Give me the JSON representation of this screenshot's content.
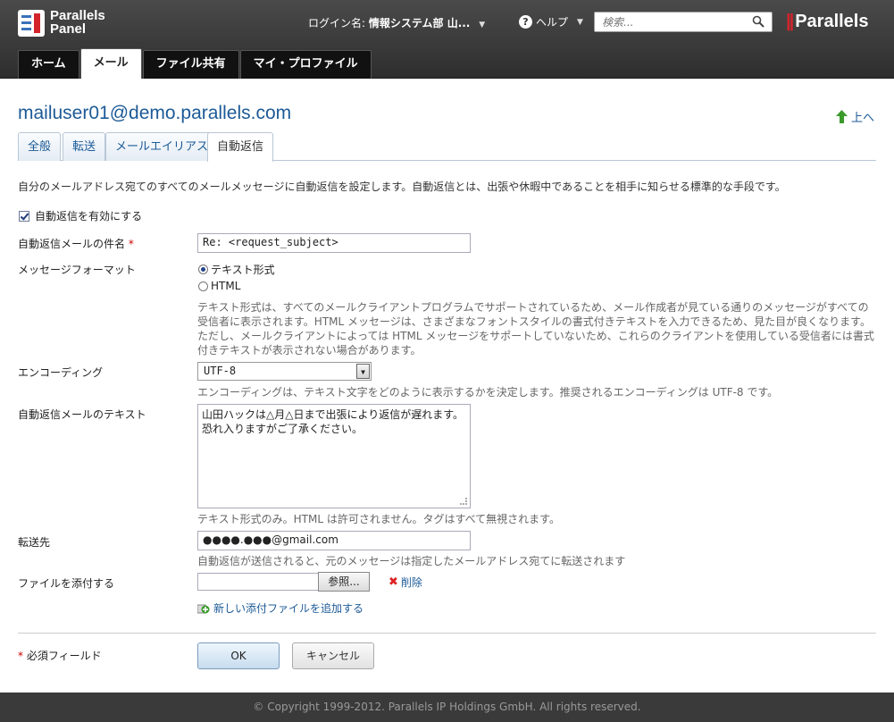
{
  "header": {
    "logo_line1": "Parallels",
    "logo_line2": "Panel",
    "login_label": "ログイン名:",
    "login_name": "情報システム部 山...",
    "help_label": "ヘルプ",
    "search_placeholder": "検索...",
    "brand": "Parallels"
  },
  "nav": {
    "tabs": [
      {
        "label": "ホーム"
      },
      {
        "label": "メール"
      },
      {
        "label": "ファイル共有"
      },
      {
        "label": "マイ・プロファイル"
      }
    ]
  },
  "page": {
    "title": "mailuser01@demo.parallels.com",
    "up_label": "上へ"
  },
  "subtabs": [
    {
      "label": "全般"
    },
    {
      "label": "転送"
    },
    {
      "label": "メールエイリアス"
    },
    {
      "label": "自動返信"
    }
  ],
  "form": {
    "description": "自分のメールアドレス宛てのすべてのメールメッセージに自動返信を設定します。自動返信とは、出張や休暇中であることを相手に知らせる標準的な手段です。",
    "enable_label": "自動返信を有効にする",
    "subject_label": "自動返信メールの件名",
    "subject_required": "*",
    "subject_value": "Re: <request_subject>",
    "format_label": "メッセージフォーマット",
    "format_text": "テキスト形式",
    "format_html": "HTML",
    "format_hint": "テキスト形式は、すべてのメールクライアントプログラムでサポートされているため、メール作成者が見ている通りのメッセージがすべての受信者に表示されます。HTML メッセージは、さまざまなフォントスタイルの書式付きテキストを入力できるため、見た目が良くなります。ただし、メールクライアントによっては HTML メッセージをサポートしていないため、これらのクライアントを使用している受信者には書式付きテキストが表示されない場合があります。",
    "encoding_label": "エンコーディング",
    "encoding_value": "UTF-8",
    "encoding_hint": "エンコーディングは、テキスト文字をどのように表示するかを決定します。推奨されるエンコーディングは UTF-8 です。",
    "text_label": "自動返信メールのテキスト",
    "text_value": "山田ハックは△月△日まで出張により返信が遅れます。恐れ入りますがご了承ください。",
    "text_hint": "テキスト形式のみ。HTML は許可されません。タグはすべて無視されます。",
    "forward_label": "転送先",
    "forward_value": "●●●●.●●●@gmail.com",
    "forward_hint": "自動返信が送信されると、元のメッセージは指定したメールアドレス宛てに転送されます",
    "attach_label": "ファイルを添付する",
    "browse_label": "参照...",
    "delete_label": "削除",
    "add_attachment_label": "新しい添付ファイルを追加する",
    "required_note_star": "*",
    "required_note": "必須フィールド",
    "ok_label": "OK",
    "cancel_label": "キャンセル"
  },
  "footer": {
    "copyright": "© Copyright 1999-2012. Parallels IP Holdings GmbH. All rights reserved."
  }
}
